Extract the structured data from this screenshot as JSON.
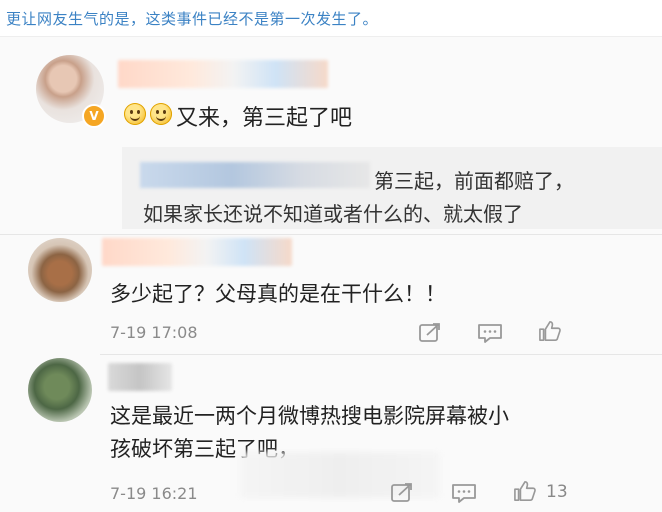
{
  "caption": "更让网友生气的是，这类事件已经不是第一次发生了。",
  "comments": [
    {
      "text": "又来，第三起了吧",
      "emojis": [
        "smile-emoji",
        "smile-emoji"
      ],
      "verified_badge": "V",
      "reply_lines": [
        "第三起，前面都赔了，",
        "如果家长还说不知道或者什么的、就太假了"
      ]
    },
    {
      "text": "多少起了？父母真的是在干什么！！",
      "time": "7-19 17:08"
    },
    {
      "lines": [
        "这是最近一两个月微博热搜电影院屏幕被小",
        "孩破坏第三起了吧，"
      ],
      "time": "7-19 16:21",
      "like_count": "13"
    }
  ],
  "icons": {
    "share": "share-icon",
    "comment": "comment-icon",
    "like": "thumbs-up-icon"
  },
  "colors": {
    "caption": "#3b82c4",
    "badge": "#f5a623",
    "icon": "#999999"
  }
}
